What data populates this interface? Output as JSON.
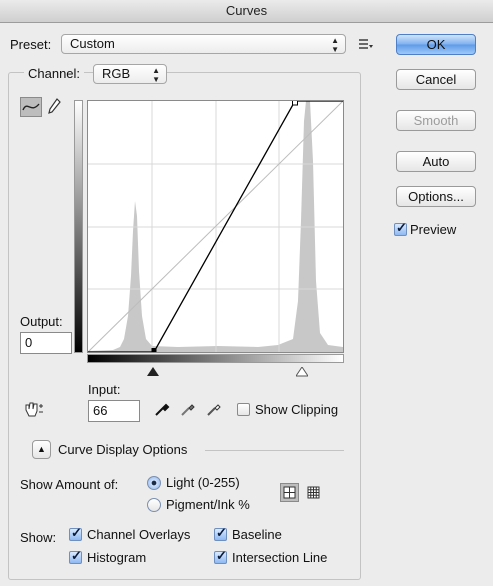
{
  "window": {
    "title": "Curves"
  },
  "preset": {
    "label": "Preset:",
    "value": "Custom"
  },
  "channel": {
    "label": "Channel:",
    "value": "RGB"
  },
  "output": {
    "label": "Output:",
    "value": "0"
  },
  "input": {
    "label": "Input:",
    "value": "66"
  },
  "show_clipping": {
    "label": "Show Clipping",
    "checked": false
  },
  "buttons": {
    "ok": "OK",
    "cancel": "Cancel",
    "smooth": "Smooth",
    "auto": "Auto",
    "options": "Options..."
  },
  "preview": {
    "label": "Preview",
    "checked": true
  },
  "curve_display_options": {
    "label": "Curve Display Options"
  },
  "show_amount": {
    "label": "Show Amount of:",
    "light": "Light  (0-255)",
    "pigment": "Pigment/Ink %",
    "selected": "light"
  },
  "show": {
    "label": "Show:",
    "channel_overlays": "Channel Overlays",
    "histogram": "Histogram",
    "baseline": "Baseline",
    "intersection_line": "Intersection Line"
  },
  "curve": {
    "black_input": 66,
    "white_input": 207,
    "scale_max": 255
  },
  "colors": {
    "accent": "#5f9ae8",
    "histogram": "#c8c8c8",
    "grid": "#d9d9d9"
  }
}
